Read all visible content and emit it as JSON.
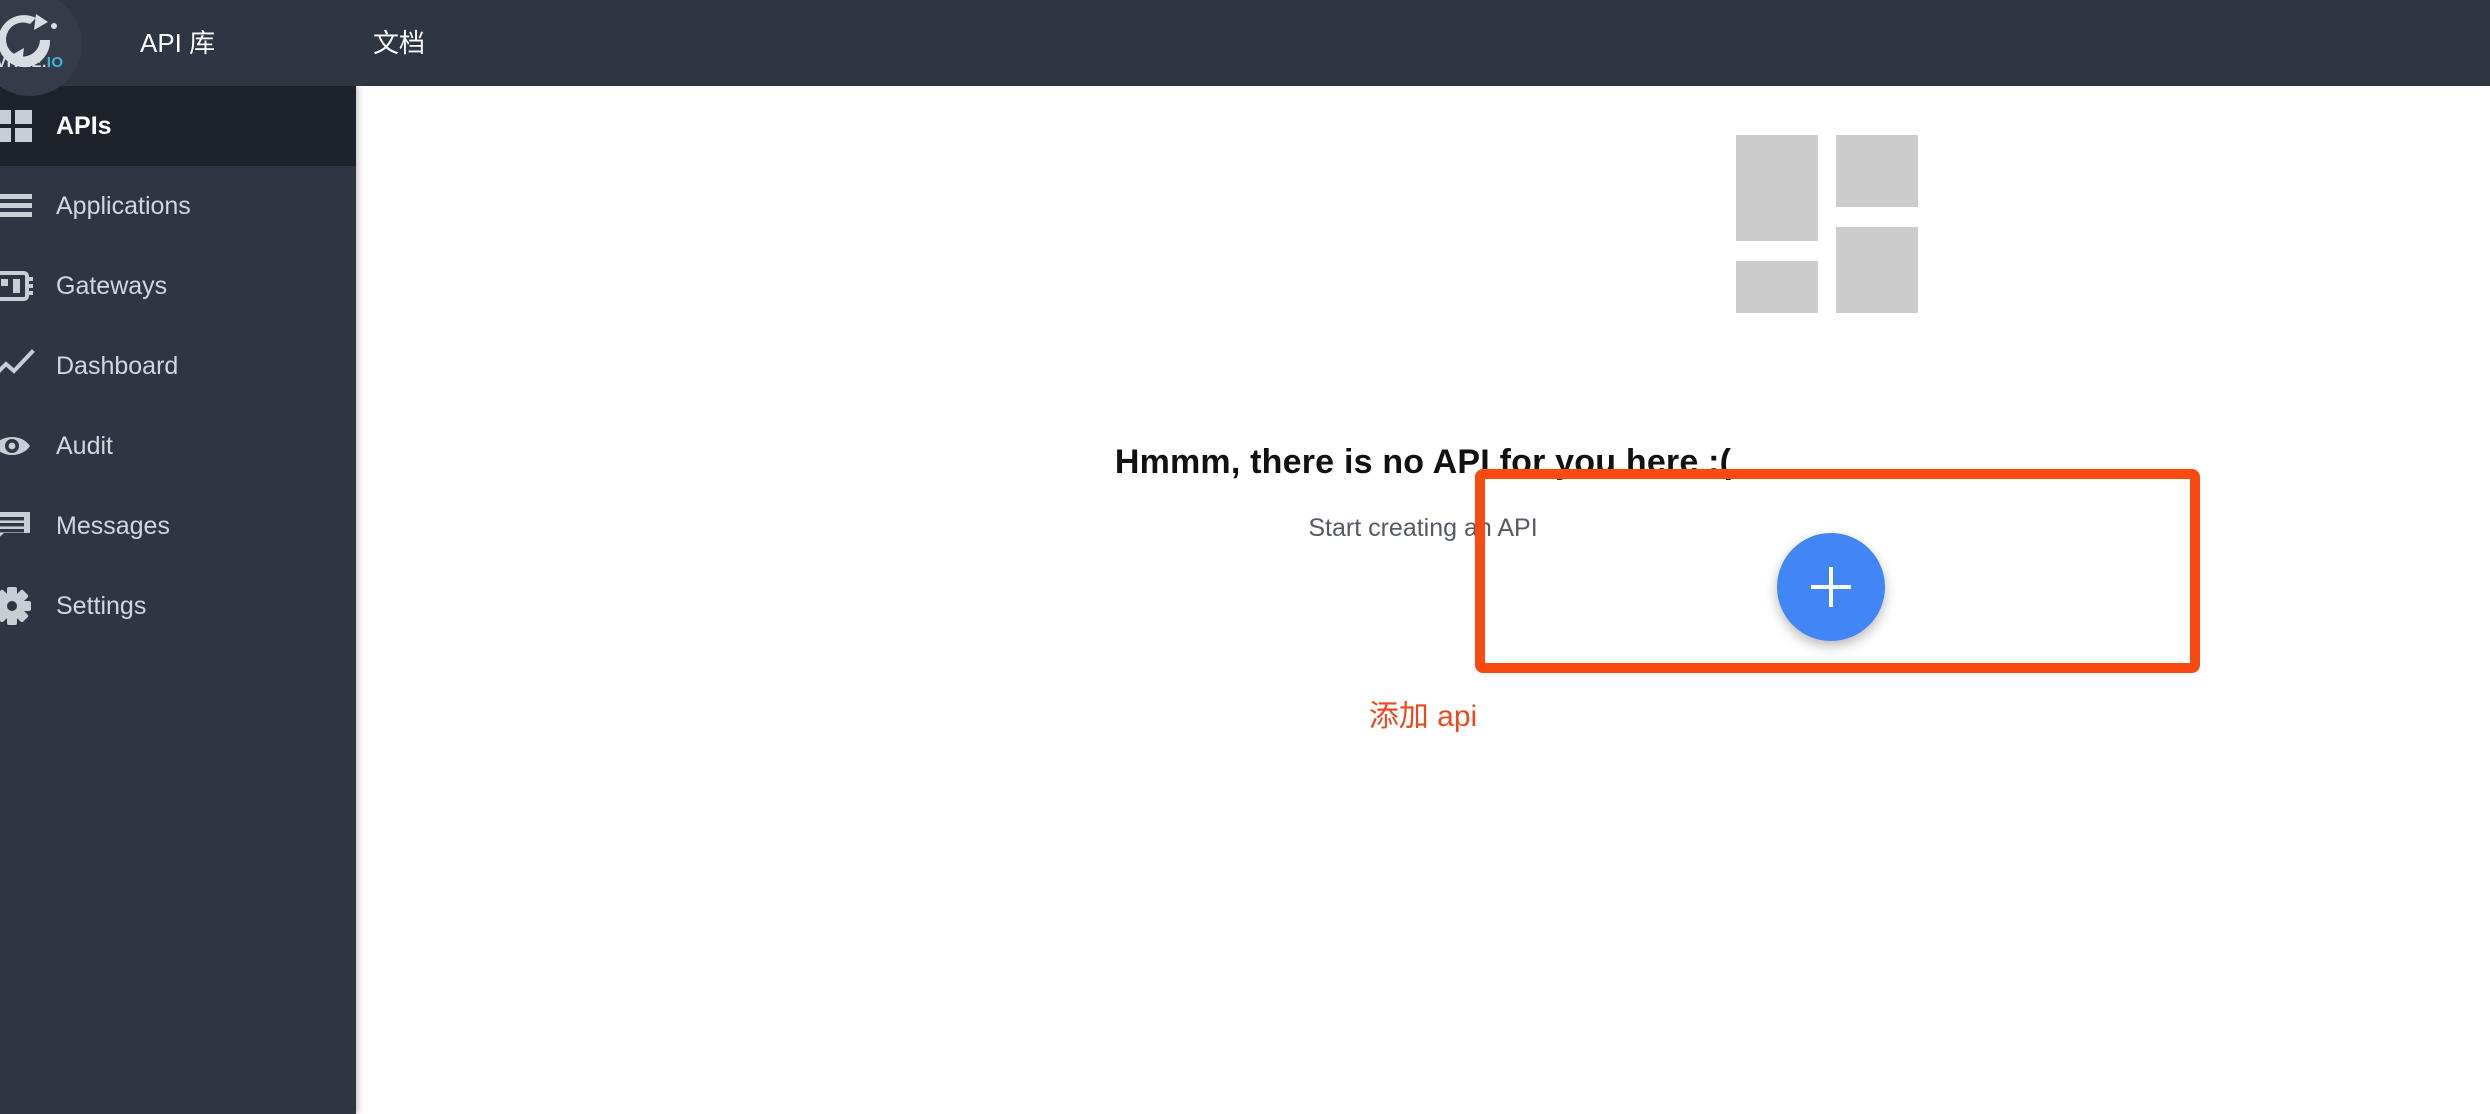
{
  "brand": {
    "name": "AVITEE.IO",
    "name_main": "AVITEE.",
    "name_suffix": "IO",
    "logo_icon": "gravitee-logo-icon",
    "bg_color": "#343c4a"
  },
  "topbar": {
    "bg_color": "#2e3643",
    "items": [
      {
        "label": "API 库",
        "name": "topnav-item-api-library"
      },
      {
        "label": "文档",
        "name": "topnav-item-documentation"
      }
    ]
  },
  "sidebar": {
    "bg_color": "#2e3643",
    "active_bg_color": "#1e222b",
    "items": [
      {
        "label": "APIs",
        "icon": "grid-blocks-icon",
        "active": true
      },
      {
        "label": "Applications",
        "icon": "list-lines-icon",
        "active": false
      },
      {
        "label": "Gateways",
        "icon": "gateway-chip-icon",
        "active": false
      },
      {
        "label": "Dashboard",
        "icon": "line-chart-icon",
        "active": false
      },
      {
        "label": "Audit",
        "icon": "eye-icon",
        "active": false
      },
      {
        "label": "Messages",
        "icon": "speech-bubble-icon",
        "active": false
      },
      {
        "label": "Settings",
        "icon": "gear-icon",
        "active": false
      }
    ]
  },
  "main": {
    "placeholder_icon": "four-blocks-placeholder-icon",
    "placeholder_color": "#cccccc",
    "empty_title": "Hmmm, there is no API for you here :(",
    "empty_subtitle": "Start creating an API",
    "add_button": {
      "icon": "plus-icon",
      "color": "#4285f4",
      "name": "add-api-fab"
    },
    "annotation": {
      "caption": "添加 api",
      "color": "#f94a10",
      "caption_color": "#e9491f"
    }
  }
}
